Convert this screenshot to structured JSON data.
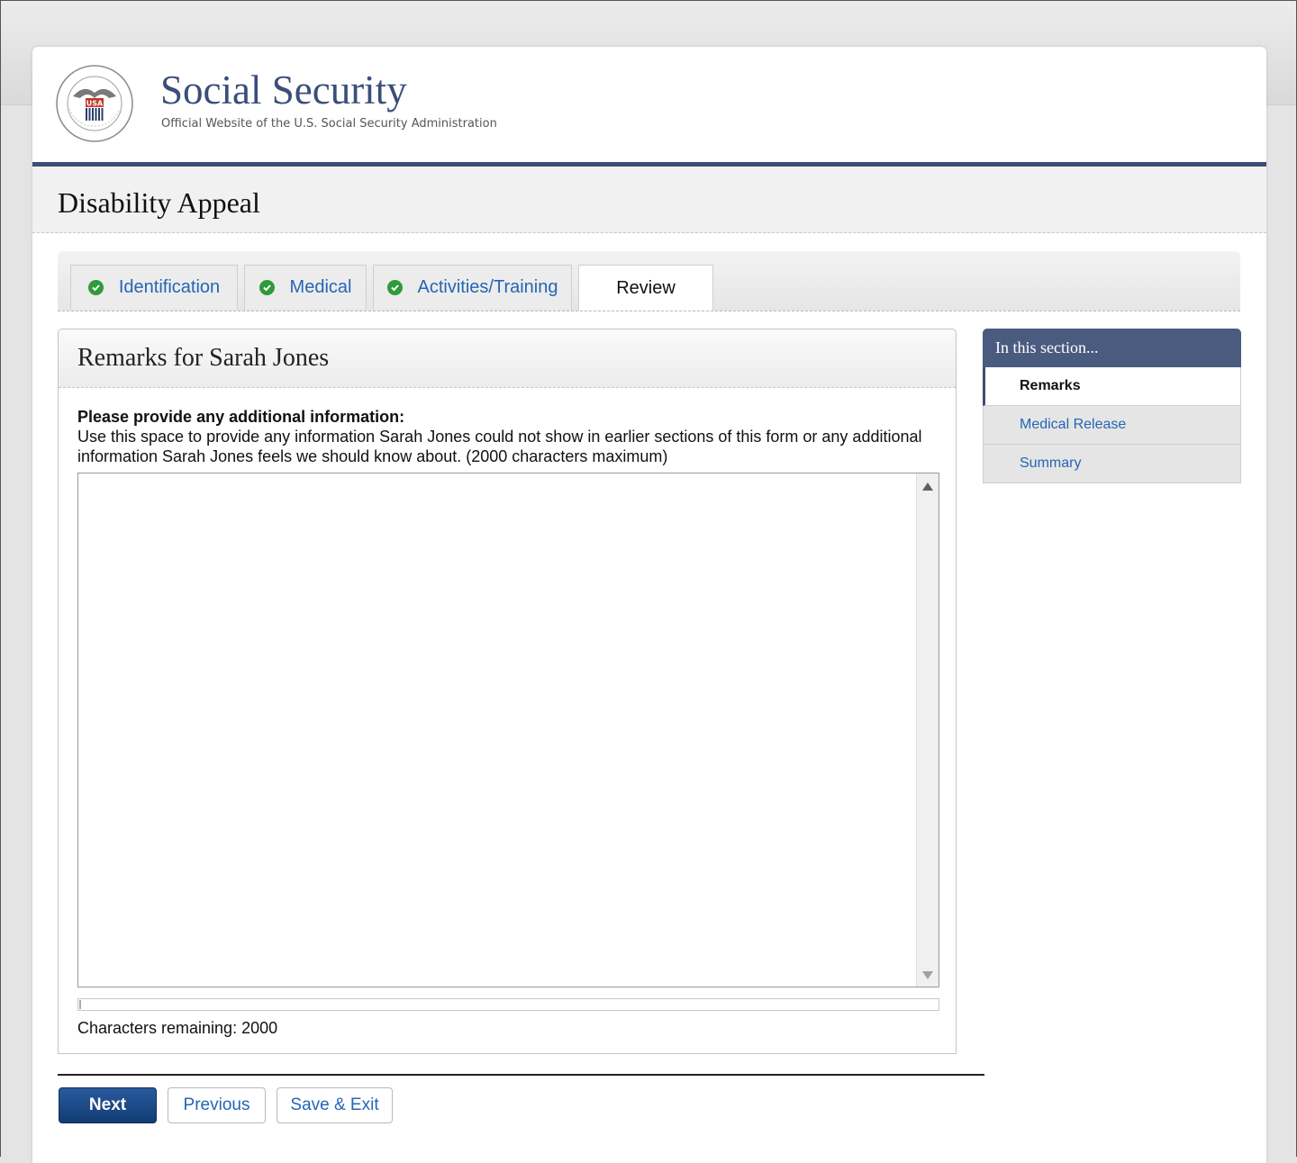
{
  "brand": {
    "title": "Social Security",
    "subtitle": "Official Website of the U.S. Social Security Administration",
    "seal_text": "USA"
  },
  "page_title": "Disability Appeal",
  "tabs": [
    {
      "label": "Identification",
      "completed": true
    },
    {
      "label": "Medical",
      "completed": true
    },
    {
      "label": "Activities/Training",
      "completed": true
    },
    {
      "label": "Review",
      "completed": false,
      "active": true
    }
  ],
  "panel": {
    "title": "Remarks for Sarah Jones",
    "prompt_bold": "Please provide any additional information:",
    "prompt_text": "Use this space to provide any information Sarah Jones could not show in earlier sections of this form or any additional information Sarah Jones feels we should know about. (2000 characters maximum)",
    "textarea_value": "",
    "counter_label": "Characters remaining:  2000"
  },
  "sidebar": {
    "heading": "In this section...",
    "items": [
      {
        "label": "Remarks",
        "active": true
      },
      {
        "label": "Medical Release",
        "active": false
      },
      {
        "label": "Summary",
        "active": false
      }
    ]
  },
  "buttons": {
    "next": "Next",
    "previous": "Previous",
    "save_exit": "Save & Exit"
  },
  "colors": {
    "brand_navy": "#3d4e72",
    "link_blue": "#2565b5",
    "check_green": "#2f9b3b"
  }
}
